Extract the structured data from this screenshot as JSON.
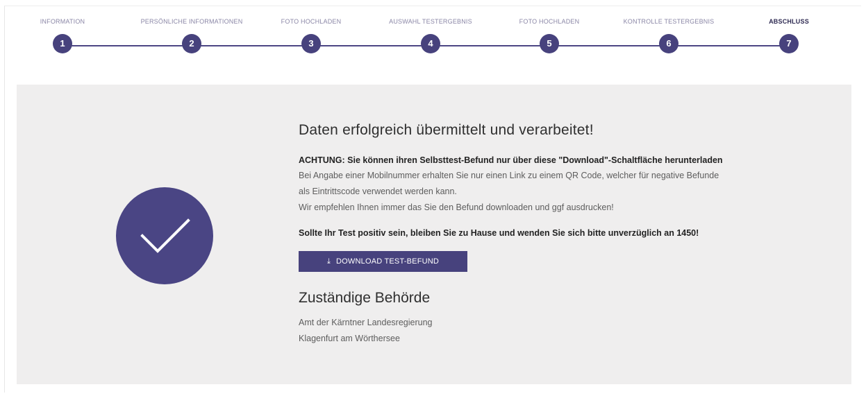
{
  "stepper": {
    "steps": [
      {
        "label": "INFORMATION",
        "number": "1"
      },
      {
        "label": "PERSÖNLICHE INFORMATIONEN",
        "number": "2"
      },
      {
        "label": "FOTO HOCHLADEN",
        "number": "3"
      },
      {
        "label": "AUSWAHL TESTERGEBNIS",
        "number": "4"
      },
      {
        "label": "FOTO HOCHLADEN",
        "number": "5"
      },
      {
        "label": "KONTROLLE TESTERGEBNIS",
        "number": "6"
      },
      {
        "label": "ABSCHLUSS",
        "number": "7"
      }
    ],
    "active_step": "7"
  },
  "result": {
    "title": "Daten erfolgreich übermittelt und verarbeitet!",
    "warning": "ACHTUNG: Sie können ihren Selbsttest-Befund nur über diese \"Download\"-Schaltfläche herunterladen",
    "info_line1": "Bei Angabe einer Mobilnummer erhalten Sie nur einen Link zu einem QR Code, welcher für negative Befunde",
    "info_line2": "als Eintrittscode verwendet werden kann.",
    "info_line3": "Wir empfehlen Ihnen immer das Sie den Befund downloaden und ggf ausdrucken!",
    "positive_notice": "Sollte Ihr Test positiv sein, bleiben Sie zu Hause und wenden Sie sich bitte unverzüglich an 1450!",
    "download_button": "DOWNLOAD TEST-BEFUND",
    "download_icon": "download-icon"
  },
  "authority": {
    "title": "Zuständige Behörde",
    "line1": "Amt der Kärntner Landesregierung",
    "line2": "Klagenfurt am Wörthersee"
  },
  "colors": {
    "accent": "#47427d",
    "panel_bg": "#efeeee"
  }
}
